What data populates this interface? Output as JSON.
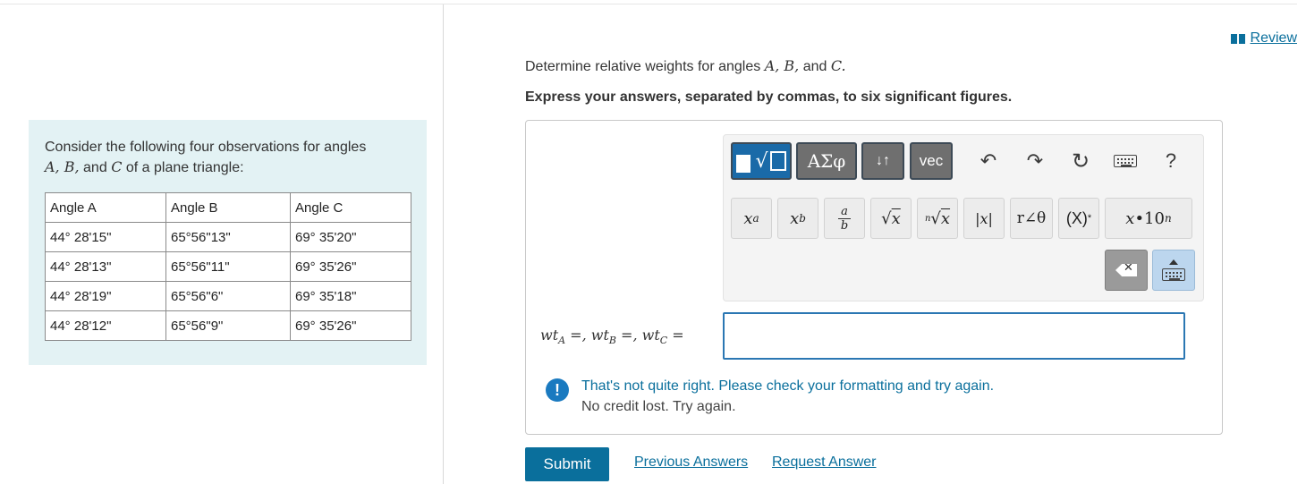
{
  "review_label": "Review",
  "left": {
    "intro_text": "Consider the following four observations for angles",
    "intro_math": "A, B,",
    "intro_and": "and",
    "intro_c": "C",
    "intro_tail": "of a plane triangle:",
    "table": {
      "headers": [
        "Angle A",
        "Angle B",
        "Angle C"
      ],
      "rows": [
        [
          "44° 28'15\"",
          "65°56\"13\"",
          "69° 35'20\""
        ],
        [
          "44° 28'13\"",
          "65°56\"11\"",
          "69° 35'26\""
        ],
        [
          "44° 28'19\"",
          "65°56\"6\"",
          "69° 35'18\""
        ],
        [
          "44° 28'12\"",
          "65°56\"9\"",
          "69° 35'26\""
        ]
      ]
    }
  },
  "question": {
    "prompt_start": "Determine relative weights for angles",
    "prompt_math": "A, B,",
    "prompt_and": "and",
    "prompt_c": "C.",
    "instruction": "Express your answers, separated by commas, to six significant figures."
  },
  "toolbar": {
    "greek": "ΑΣφ",
    "arrows": "↓↑",
    "vec": "vec",
    "undo": "↶",
    "redo": "↷",
    "reset": "↻",
    "help": "?",
    "keys": [
      "xa",
      "xb",
      "a/b",
      "√x",
      "ⁿ√x",
      "|x|",
      "r∠θ",
      "(X)*",
      "x•10n"
    ]
  },
  "answer": {
    "label": "wtA =, wtB =, wtC =",
    "value": ""
  },
  "feedback": {
    "icon": "!",
    "title": "That's not quite right. Please check your formatting and try again.",
    "subtitle": "No credit lost. Try again."
  },
  "actions": {
    "submit": "Submit",
    "previous": "Previous Answers",
    "request": "Request Answer"
  }
}
